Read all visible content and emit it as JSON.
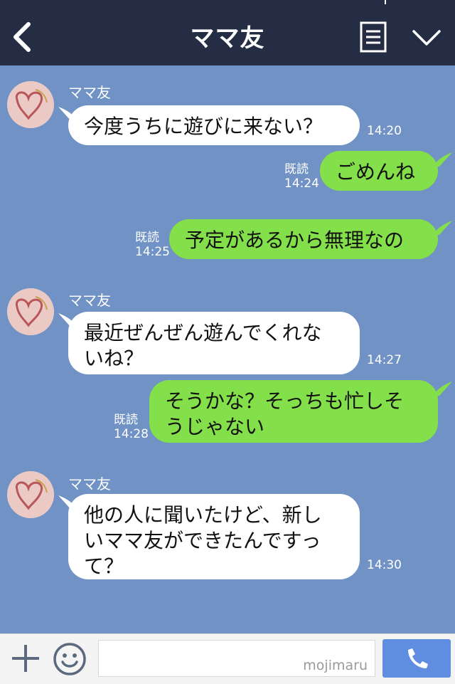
{
  "header": {
    "title": "ママ友",
    "back_icon": "chevron-left-icon",
    "menu_icon": "list-menu-icon",
    "collapse_icon": "chevron-down-icon"
  },
  "messages": [
    {
      "side": "in",
      "sender": "ママ友",
      "text": "今度うちに遊びに来ない？",
      "time": "14:20"
    },
    {
      "side": "out",
      "read": "既読",
      "text": "ごめんね",
      "time": "14:24"
    },
    {
      "side": "out",
      "read": "既読",
      "text": "予定があるから無理なの",
      "time": "14:25"
    },
    {
      "side": "in",
      "sender": "ママ友",
      "text_lines": [
        "最近ぜんぜん遊んでくれな",
        "いね？"
      ],
      "time": "14:27"
    },
    {
      "side": "out",
      "read": "既読",
      "text_lines": [
        "そうかな？そっちも忙しそ",
        "うじゃない"
      ],
      "time": "14:28"
    },
    {
      "side": "in",
      "sender": "ママ友",
      "text_lines": [
        "他の人に聞いたけど、新し",
        "いママ友ができたんですっ",
        "て？"
      ],
      "time": "14:30"
    }
  ],
  "footer": {
    "plus_icon": "plus-icon",
    "emoji_icon": "smiley-icon",
    "input_value": "",
    "watermark": "mojimaru",
    "call_icon": "phone-icon"
  },
  "colors": {
    "header_bg": "#242d44",
    "chat_bg": "#7092c4",
    "incoming_bubble": "#ffffff",
    "outgoing_bubble": "#84e04a",
    "call_button": "#5f8de0"
  }
}
